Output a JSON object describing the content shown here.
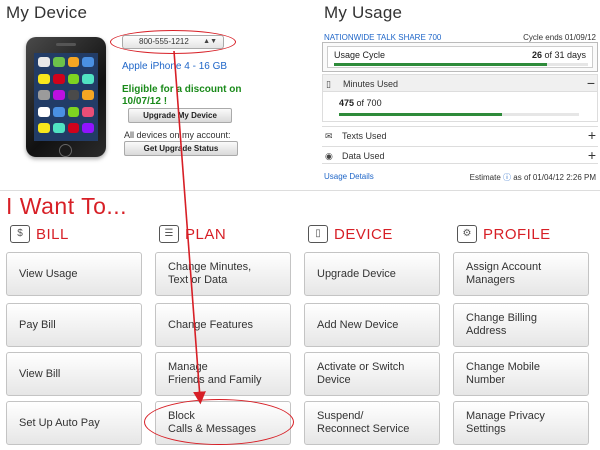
{
  "device": {
    "title": "My Device",
    "phone_number": "800-555-1212",
    "model": "Apple iPhone 4 - 16 GB",
    "discount_line1": "Eligible for a discount on",
    "discount_line2": "10/07/12 !",
    "upgrade_button": "Upgrade My Device",
    "all_devices_label": "All devices on my account:",
    "upgrade_status_button": "Get Upgrade Status",
    "app_colors": [
      "#e8e8e8",
      "#6cc24a",
      "#f5a623",
      "#4a90e2",
      "#f8e71c",
      "#d0021b",
      "#7ed321",
      "#50e3c2",
      "#9b9b9b",
      "#bd10e0",
      "#4a4a4a",
      "#f5a623",
      "#ffffff",
      "#4a90e2",
      "#7ed321",
      "#e94e77",
      "#f8e71c",
      "#50e3c2",
      "#d0021b",
      "#9013fe"
    ]
  },
  "usage": {
    "title": "My Usage",
    "plan_name": "NATIONWIDE TALK SHARE 700",
    "cycle_ends": "Cycle ends 01/09/12",
    "cycle_label": "Usage Cycle",
    "cycle_used": "26",
    "cycle_total": "of 31 days",
    "cycle_fraction": 0.84,
    "minutes_label": "Minutes Used",
    "minutes_toggle": "−",
    "minutes_used": "475",
    "minutes_total": "of 700",
    "minutes_fraction": 0.68,
    "texts_label": "Texts Used",
    "texts_toggle": "+",
    "data_label": "Data Used",
    "data_toggle": "+",
    "details_link": "Usage Details",
    "estimate_label": "Estimate",
    "estimate_date": "as of 01/04/12 2:26 PM",
    "estimate_icon": "info-icon"
  },
  "want_to": {
    "title": "I Want To...",
    "columns": [
      {
        "heading": "BILL",
        "icon": "dollar-icon",
        "icon_glyph": "$",
        "buttons": [
          "View Usage",
          "Pay Bill",
          "View Bill",
          "Set Up Auto Pay"
        ]
      },
      {
        "heading": "PLAN",
        "icon": "plan-icon",
        "icon_glyph": "☰",
        "buttons": [
          "Change Minutes,\nText or Data",
          "Change Features",
          "Manage\nFriends and Family",
          "Block\nCalls & Messages"
        ]
      },
      {
        "heading": "DEVICE",
        "icon": "device-icon",
        "icon_glyph": "▯",
        "buttons": [
          "Upgrade Device",
          "Add New Device",
          "Activate or Switch\nDevice",
          "Suspend/\nReconnect Service"
        ]
      },
      {
        "heading": "PROFILE",
        "icon": "profile-gear-icon",
        "icon_glyph": "⚙",
        "buttons": [
          "Assign Account\nManagers",
          "Change Billing\nAddress",
          "Change Mobile\nNumber",
          "Manage Privacy\nSettings"
        ]
      }
    ]
  },
  "colors": {
    "brand_red": "#d71f26",
    "link_blue": "#1f66c8",
    "progress_green": "#2e8b3a",
    "discount_green": "#1a8a1a"
  }
}
